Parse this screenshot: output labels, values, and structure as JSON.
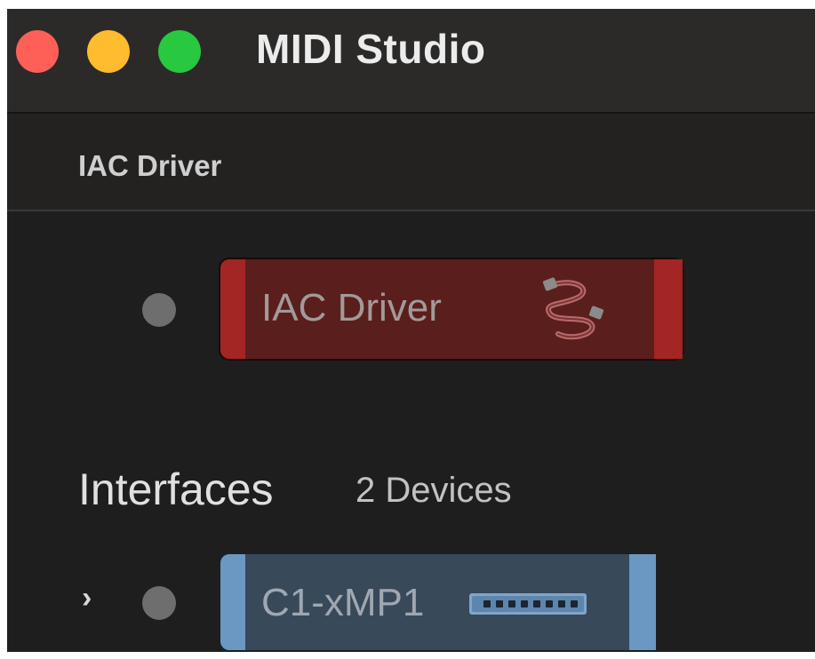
{
  "window": {
    "title": "MIDI Studio"
  },
  "section": {
    "header_label": "IAC Driver"
  },
  "iac_device": {
    "name": "IAC Driver",
    "icon": "midi-cable-icon",
    "color": "#a32524"
  },
  "interfaces": {
    "title": "Interfaces",
    "count_label": "2 Devices",
    "devices": [
      {
        "name": "C1-xMP1",
        "icon": "midi-interface-ports-icon",
        "color": "#6b97c3"
      }
    ]
  },
  "colors": {
    "close": "#fe5f57",
    "minimize": "#febc2e",
    "zoom": "#28c840",
    "status_dot": "#6e6e6e"
  }
}
